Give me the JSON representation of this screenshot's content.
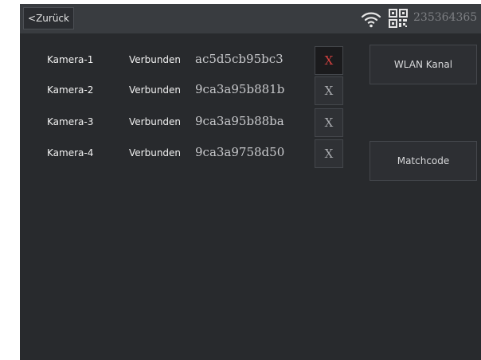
{
  "topbar": {
    "back_label": "<Zurück",
    "wifi_icon": "wifi-icon",
    "qr_icon": "qr-code-icon",
    "device_id": "235364365"
  },
  "cameras": [
    {
      "name": "Kamera-1",
      "status": "Verbunden",
      "mac": "ac5d5cb95bc3",
      "remove_label": "X",
      "selected": true
    },
    {
      "name": "Kamera-2",
      "status": "Verbunden",
      "mac": "9ca3a95b881b",
      "remove_label": "X",
      "selected": false
    },
    {
      "name": "Kamera-3",
      "status": "Verbunden",
      "mac": "9ca3a95b88ba",
      "remove_label": "X",
      "selected": false
    },
    {
      "name": "Kamera-4",
      "status": "Verbunden",
      "mac": "9ca3a9758d50",
      "remove_label": "X",
      "selected": false
    }
  ],
  "side_buttons": {
    "wlan_label": "WLAN Kanal",
    "matchcode_label": "Matchcode"
  },
  "colors": {
    "background": "#282a2d",
    "topbar": "#393c40",
    "active_x": "#d1403f"
  }
}
